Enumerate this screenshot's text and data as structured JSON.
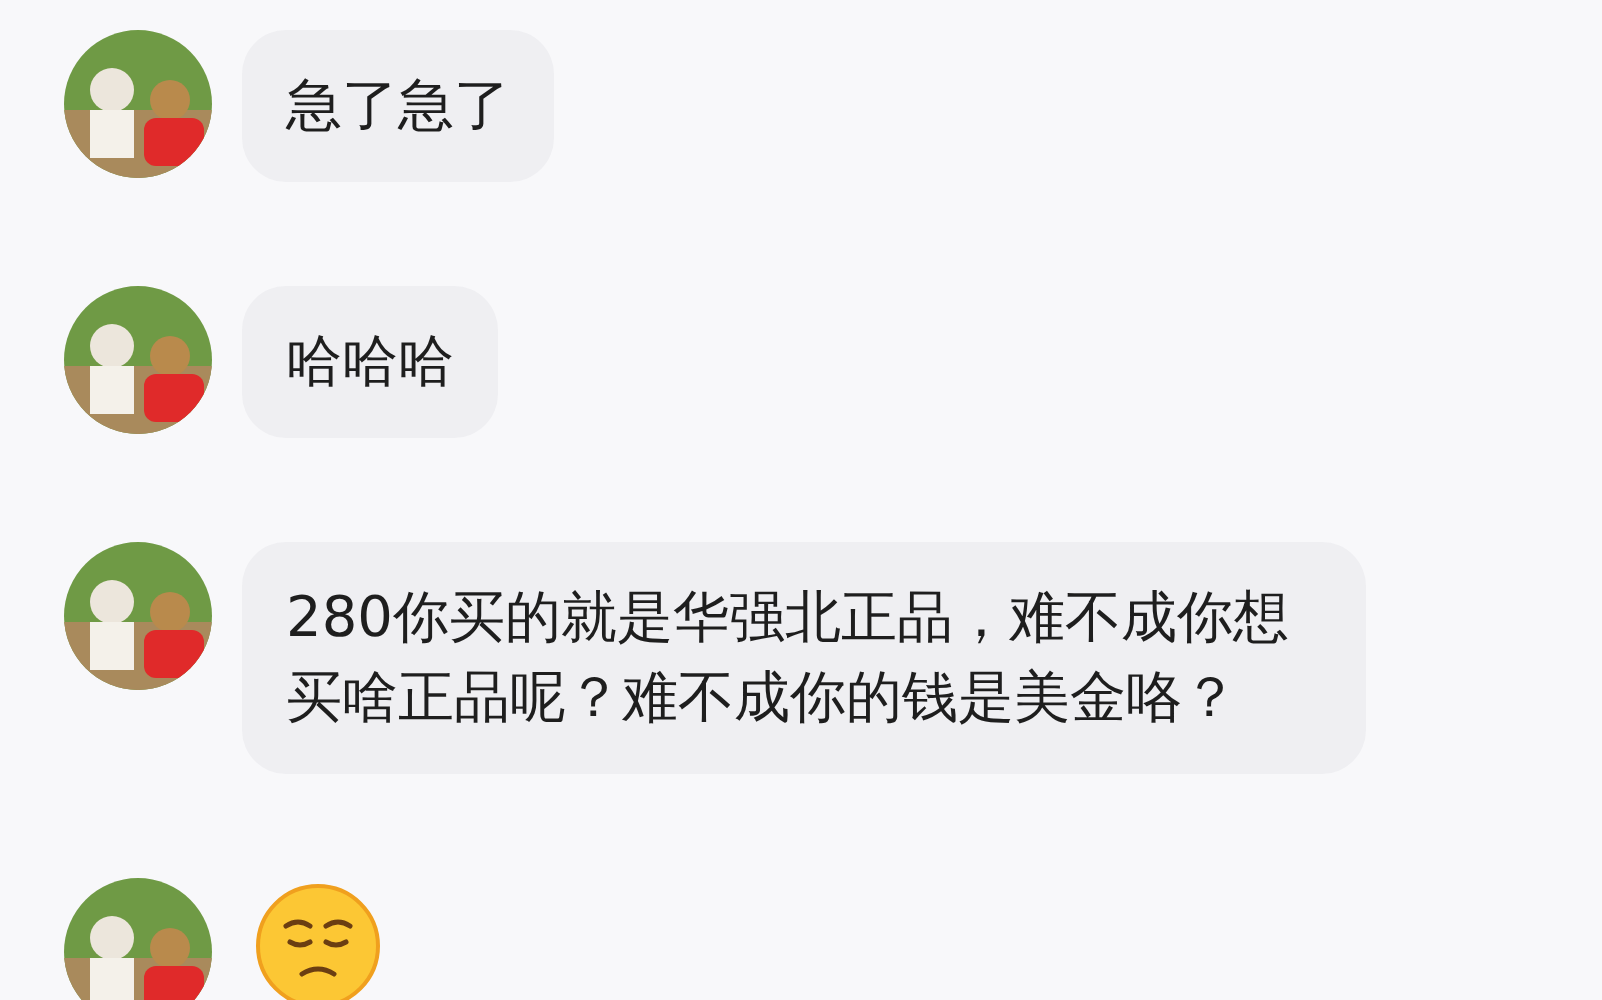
{
  "messages": [
    {
      "kind": "text",
      "text": "急了急了"
    },
    {
      "kind": "text",
      "text": "哈哈哈"
    },
    {
      "kind": "text",
      "text": "280你买的就是华强北正品，难不成你想买啥正品呢？难不成你的钱是美金咯？"
    },
    {
      "kind": "emoji"
    }
  ]
}
